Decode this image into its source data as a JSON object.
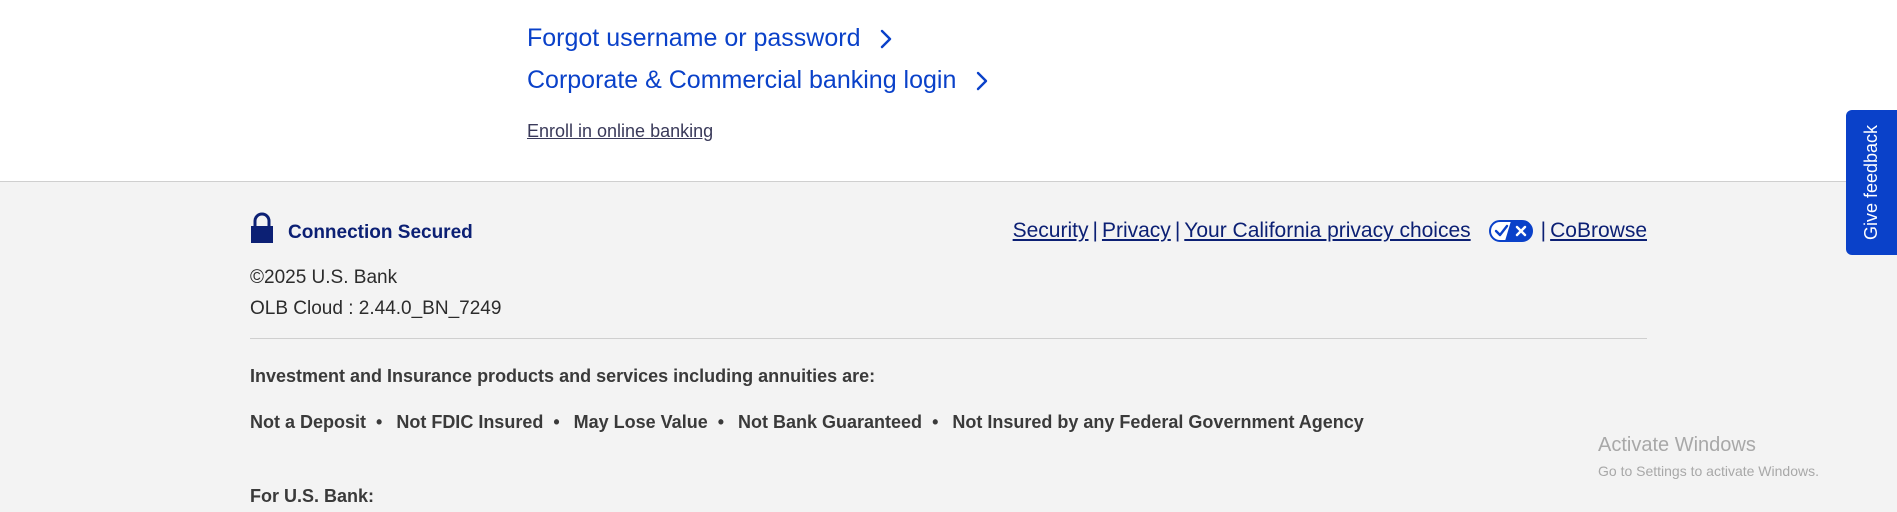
{
  "links": {
    "forgot": "Forgot username or password",
    "corporate": "Corporate & Commercial banking login",
    "enroll": "Enroll in online banking"
  },
  "footer": {
    "connection": "Connection Secured",
    "copyright": "©2025 U.S. Bank",
    "build": "OLB Cloud : 2.44.0_BN_7249",
    "legal": {
      "security": "Security",
      "privacy": "Privacy",
      "california": "Your California privacy choices",
      "cobrowse": "CoBrowse",
      "separator": "|"
    },
    "invest_heading": "Investment and Insurance products and services including annuities are:",
    "disclosures": [
      "Not a Deposit",
      "Not FDIC Insured",
      "May Lose Value",
      "Not Bank Guaranteed",
      "Not Insured by any Federal Government Agency"
    ],
    "bullet": "•",
    "for_bank": "For U.S. Bank:"
  },
  "watermark": {
    "title": "Activate Windows",
    "subtitle": "Go to Settings to activate Windows."
  },
  "feedback": {
    "label": "Give feedback"
  },
  "colors": {
    "link_blue": "#0a41c9",
    "navy": "#0c2074",
    "footer_bg": "#f3f3f3"
  },
  "icons": {
    "chevron": "chevron-right-icon",
    "lock": "lock-icon",
    "privacy_toggle": "privacy-choices-icon"
  }
}
